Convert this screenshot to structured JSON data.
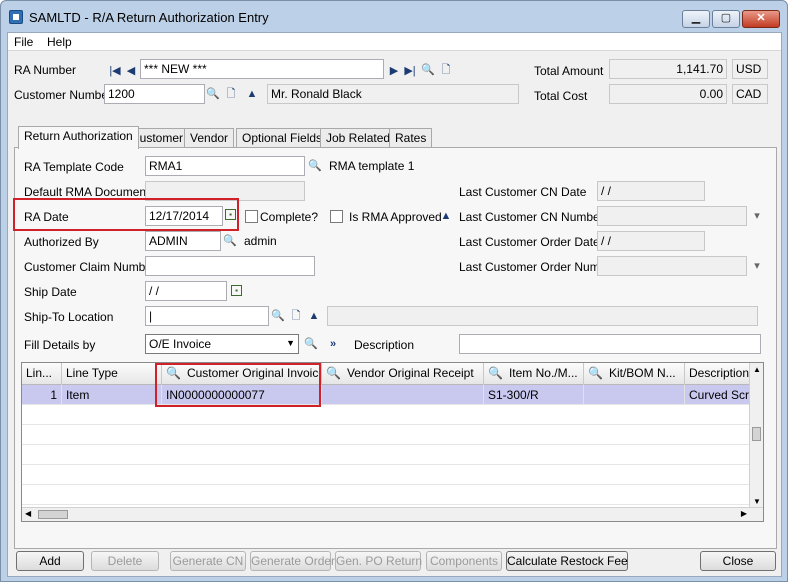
{
  "window": {
    "title": "SAMLTD - R/A Return Authorization Entry",
    "min": "▁",
    "max": "▢",
    "close": "✕"
  },
  "menu": {
    "file": "File",
    "help": "Help"
  },
  "header": {
    "ra_number_label": "RA Number",
    "ra_number_value": "*** NEW ***",
    "customer_number_label": "Customer Number",
    "customer_number_value": "1200",
    "customer_name": "Mr. Ronald Black",
    "total_amount_label": "Total Amount",
    "total_amount_value": "1,141.70",
    "total_amount_currency": "USD",
    "total_cost_label": "Total Cost",
    "total_cost_value": "0.00",
    "total_cost_currency": "CAD"
  },
  "tabs": [
    "Return Authorization",
    "Customer",
    "Vendor",
    "Optional Fields",
    "Job Related",
    "Rates"
  ],
  "form": {
    "ra_template_code_label": "RA Template Code",
    "ra_template_code_value": "RMA1",
    "ra_template_desc": "RMA template 1",
    "default_rma_label": "Default RMA Document",
    "ra_date_label": "RA Date",
    "ra_date_value": "12/17/2014",
    "complete_label": "Complete?",
    "is_rma_label": "Is RMA Approved",
    "authorized_by_label": "Authorized By",
    "authorized_by_value": "ADMIN",
    "authorized_by_desc": "admin",
    "customer_claim_label": "Customer Claim Number",
    "ship_date_label": "Ship Date",
    "ship_date_value": " / /",
    "ship_to_label": "Ship-To Location",
    "fill_details_label": "Fill Details by",
    "fill_details_value": "O/E Invoice",
    "description_label": "Description",
    "last_cn_date_label": "Last Customer CN Date",
    "last_cn_date_value": " / /",
    "last_cn_number_label": "Last Customer CN Number",
    "last_order_date_label": "Last Customer Order Date",
    "last_order_date_value": " / /",
    "last_order_number_label": "Last Customer Order Number"
  },
  "grid": {
    "columns": [
      "Lin...",
      "Line Type",
      "Customer Original Invoice",
      "Vendor Original Receipt",
      "Item No./M...",
      "Kit/BOM N...",
      "Description"
    ],
    "rows": [
      {
        "line": "1",
        "type": "Item",
        "invoice": "IN0000000000077",
        "receipt": "",
        "item": "S1-300/R",
        "kit": "",
        "desc": "Curved Scree"
      }
    ]
  },
  "buttons": {
    "add": "Add",
    "delete": "Delete",
    "generate_cn": "Generate CN",
    "generate_order": "Generate Order",
    "gen_po_return": "Gen. PO Return",
    "components": "Components",
    "calc_restock": "Calculate Restock Fee",
    "close": "Close"
  },
  "colors": {
    "highlight_red": "#d0202a",
    "selected_row": "#c9c9f0"
  }
}
